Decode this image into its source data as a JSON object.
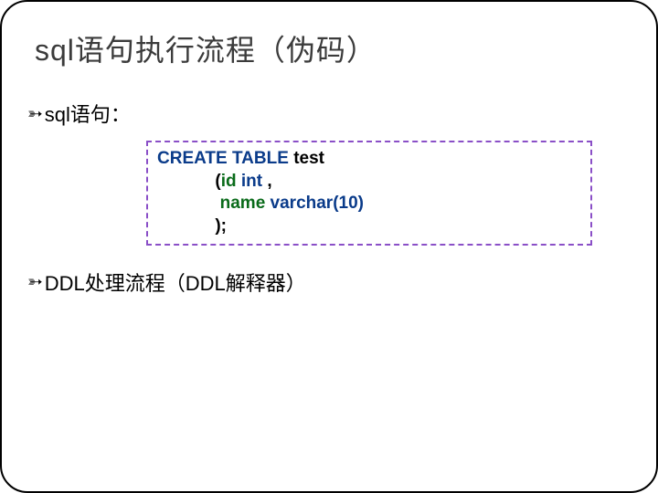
{
  "slide": {
    "title": "sql语句执行流程（伪码）",
    "bullets": {
      "first": "sql语句：",
      "second": "DDL处理流程（DDL解释器）"
    },
    "code": {
      "line1_keyword": "CREATE TABLE ",
      "line1_rest": "test",
      "line2_indent": "            (",
      "line2_id": "id",
      "line2_type": " int ",
      "line2_comma": ",",
      "line3_indent": "             ",
      "line3_name": "name",
      "line3_type": " varchar(10)",
      "line4_indent": "            ",
      "line4_close": ");"
    }
  }
}
